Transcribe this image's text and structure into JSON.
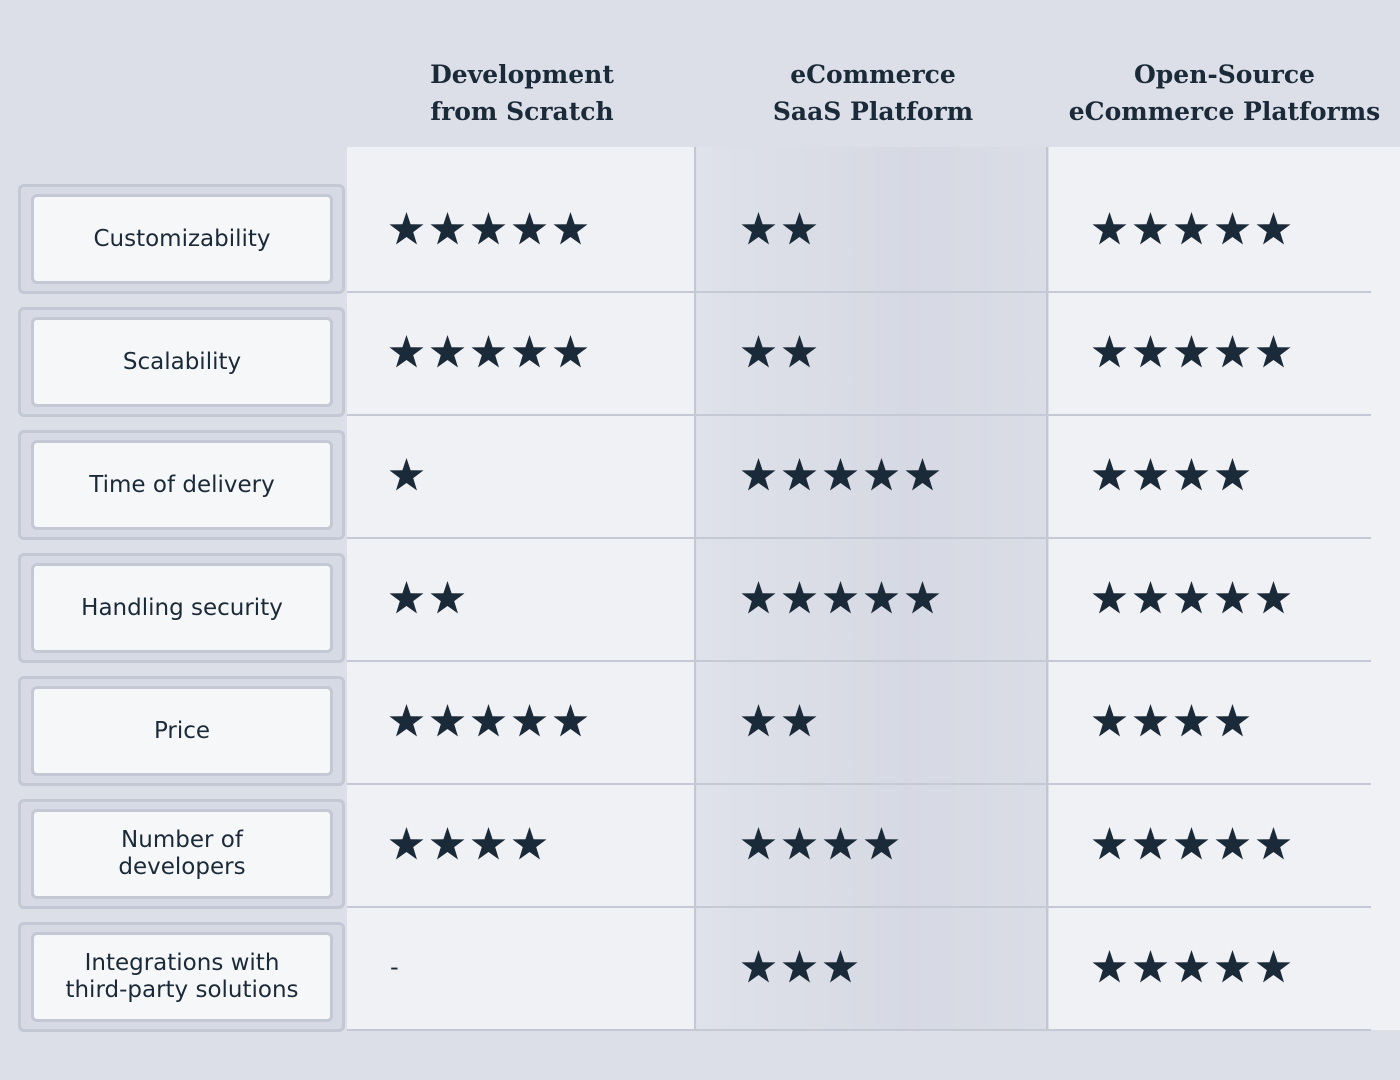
{
  "columns": [
    {
      "label": "Development\nfrom Scratch"
    },
    {
      "label": "eCommerce\nSaaS Platform"
    },
    {
      "label": "Open-Source\neCommerce Platforms"
    }
  ],
  "rows": [
    {
      "label": "Customizability",
      "ratings": [
        5,
        2,
        5
      ]
    },
    {
      "label": "Scalability",
      "ratings": [
        5,
        2,
        5
      ]
    },
    {
      "label": "Time of delivery",
      "ratings": [
        1,
        5,
        4
      ]
    },
    {
      "label": "Handling security",
      "ratings": [
        2,
        5,
        5
      ]
    },
    {
      "label": "Price",
      "ratings": [
        5,
        2,
        4
      ]
    },
    {
      "label": "Number of\ndevelopers",
      "ratings": [
        4,
        4,
        5
      ]
    },
    {
      "label": "Integrations with\nthird-party solutions",
      "ratings": [
        null,
        3,
        5
      ]
    }
  ],
  "empty_rating_text": "-",
  "icons": {
    "rating": "star-icon"
  },
  "colors": {
    "star": "#1b2a38",
    "text": "#1b2a38",
    "background": "#dcdfe8"
  }
}
